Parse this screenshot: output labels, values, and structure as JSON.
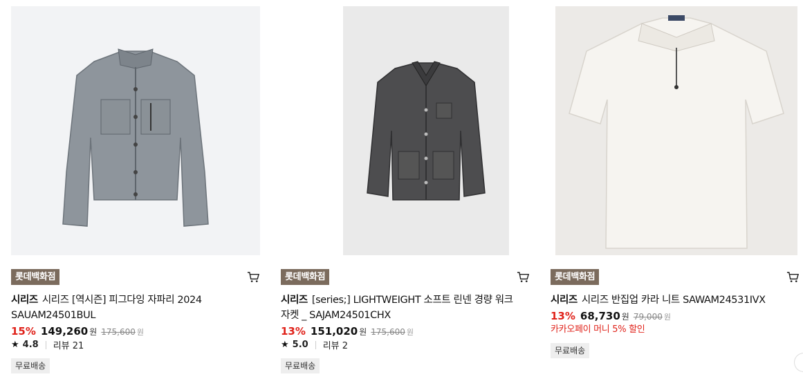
{
  "products": [
    {
      "store_badge": "롯데백화점",
      "brand": "시리즈",
      "name": "시리즈 [역시즌] 피그다잉 자파리 2024 SAUAM24501BUL",
      "discount": "15%",
      "price": "149,260",
      "currency": "원",
      "original_price": "175,600",
      "rating": "4.8",
      "review_label": "리뷰 21",
      "shipping": "무료배송",
      "icons": {
        "cart": "cart-icon",
        "star": "star-icon"
      }
    },
    {
      "store_badge": "롯데백화점",
      "brand": "시리즈",
      "name": "[series;] LIGHTWEIGHT 소프트 린넨 경량 워크 자켓 _ SAJAM24501CHX",
      "discount": "13%",
      "price": "151,020",
      "currency": "원",
      "original_price": "175,600",
      "rating": "5.0",
      "review_label": "리뷰 2",
      "shipping": "무료배송",
      "icons": {
        "cart": "cart-icon",
        "star": "star-icon"
      }
    },
    {
      "store_badge": "롯데백화점",
      "brand": "시리즈",
      "name": "시리즈 반집업 카라 니트 SAWAM24531IVX",
      "discount": "13%",
      "price": "68,730",
      "currency": "원",
      "original_price": "79,000",
      "promo": "카카오페이 머니 5% 할인",
      "shipping": "무료배송",
      "icons": {
        "cart": "cart-icon"
      }
    }
  ],
  "colors": {
    "badge_bg": "#7b6b5d",
    "discount_red": "#e0221a",
    "chip_bg": "#eeeeee"
  }
}
